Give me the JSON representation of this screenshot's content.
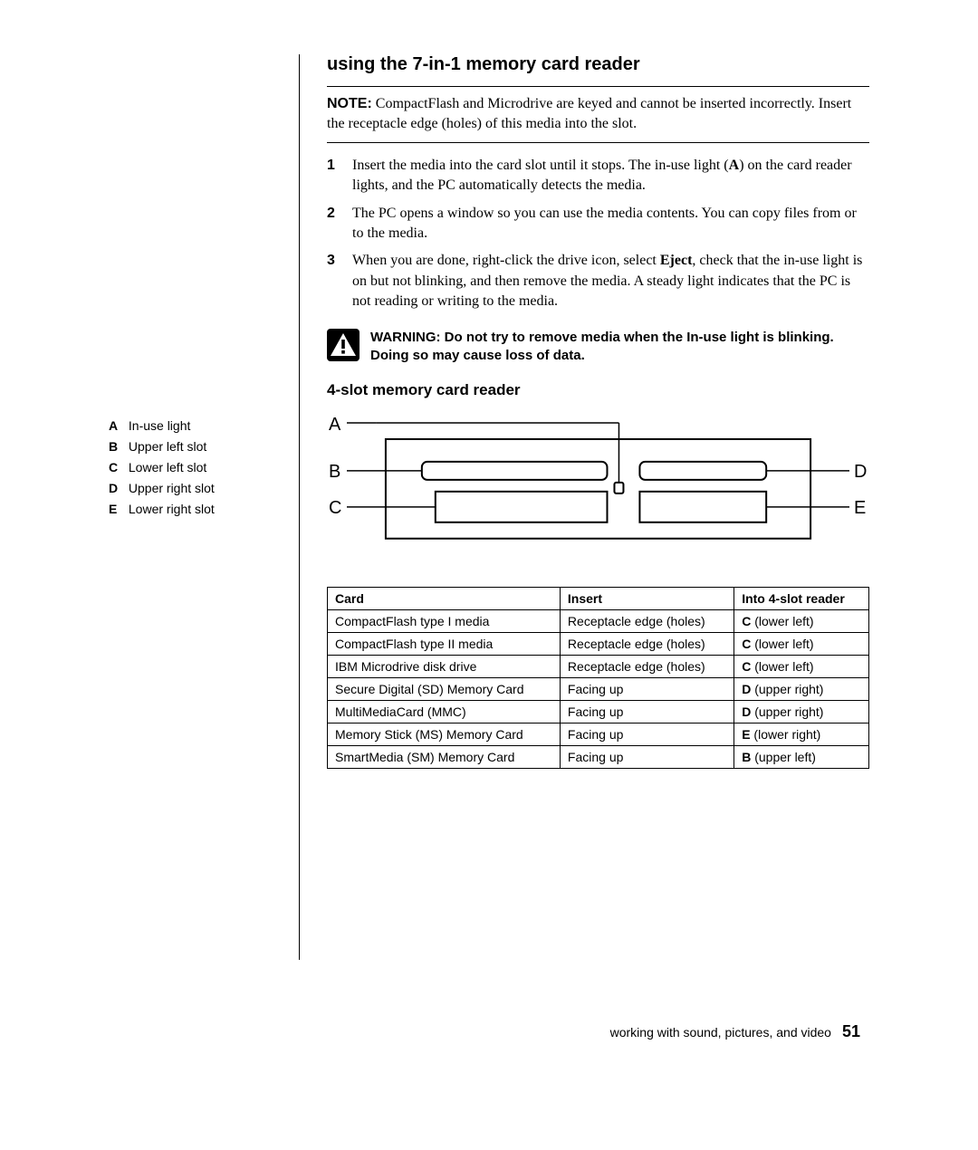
{
  "title": "using the 7-in-1 memory card reader",
  "note": {
    "label": "NOTE:",
    "text": "CompactFlash and Microdrive are keyed and cannot be inserted incorrectly. Insert the receptacle edge (holes) of this media into the slot."
  },
  "steps": [
    {
      "pre": "Insert the media into the card slot until it stops. The in-use light (",
      "bold": "A",
      "post": ") on the card reader lights, and the PC automatically detects the media."
    },
    {
      "pre": "The PC opens a window so you can use the media contents. You can copy files from or to the media.",
      "bold": "",
      "post": ""
    },
    {
      "pre": "When you are done, right-click the drive icon, select ",
      "bold": "Eject",
      "post": ", check that the in-use light is on but not blinking, and then remove the media. A steady light indicates that the PC is not reading or writing to the media."
    }
  ],
  "warning": {
    "label": "WARNING:",
    "text": "Do not try to remove media when the In-use light is blinking. Doing so may cause loss of data."
  },
  "subheading": "4-slot memory card reader",
  "legend": [
    {
      "key": "A",
      "label": "In-use light"
    },
    {
      "key": "B",
      "label": "Upper left slot"
    },
    {
      "key": "C",
      "label": "Lower left slot"
    },
    {
      "key": "D",
      "label": "Upper right slot"
    },
    {
      "key": "E",
      "label": "Lower right slot"
    }
  ],
  "diagram_labels": {
    "A": "A",
    "B": "B",
    "C": "C",
    "D": "D",
    "E": "E"
  },
  "table": {
    "headers": [
      "Card",
      "Insert",
      "Into 4-slot reader"
    ],
    "rows": [
      {
        "card": "CompactFlash type I media",
        "insert": "Receptacle edge (holes)",
        "slot_key": "C",
        "slot_pos": " (lower left)"
      },
      {
        "card": "CompactFlash type II media",
        "insert": "Receptacle edge (holes)",
        "slot_key": "C",
        "slot_pos": " (lower left)"
      },
      {
        "card": "IBM Microdrive disk drive",
        "insert": "Receptacle edge (holes)",
        "slot_key": "C",
        "slot_pos": " (lower left)"
      },
      {
        "card": "Secure Digital (SD) Memory Card",
        "insert": "Facing up",
        "slot_key": "D",
        "slot_pos": " (upper right)"
      },
      {
        "card": "MultiMediaCard (MMC)",
        "insert": "Facing up",
        "slot_key": "D",
        "slot_pos": " (upper right)"
      },
      {
        "card": "Memory Stick (MS) Memory Card",
        "insert": "Facing up",
        "slot_key": "E",
        "slot_pos": " (lower right)"
      },
      {
        "card": "SmartMedia (SM) Memory Card",
        "insert": "Facing up",
        "slot_key": "B",
        "slot_pos": " (upper left)"
      }
    ]
  },
  "footer": {
    "text": "working with sound, pictures, and video",
    "page": "51"
  }
}
